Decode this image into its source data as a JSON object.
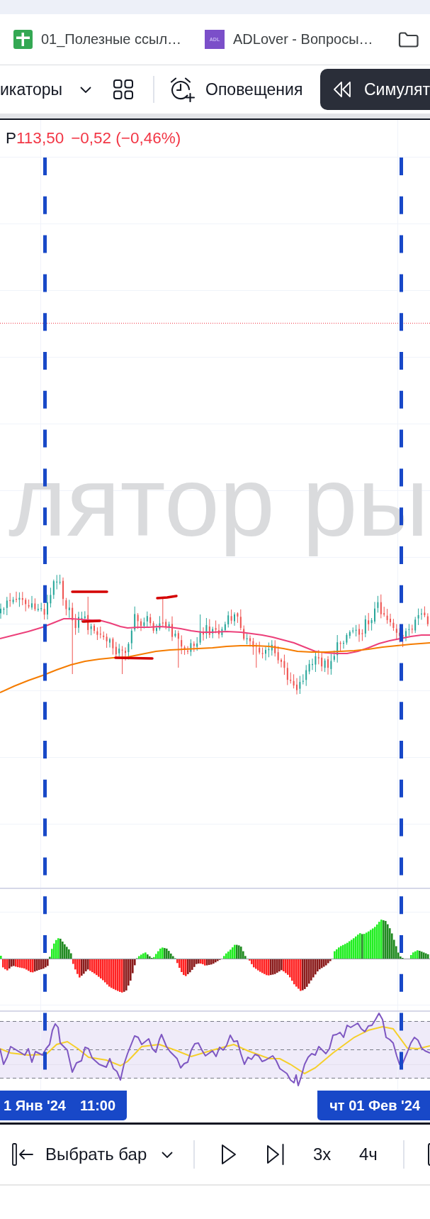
{
  "bookmarks": [
    {
      "kind": "sheet",
      "label": "01_Полезные ссыл…"
    },
    {
      "kind": "site",
      "logo_text": "ADL",
      "label": "ADLover - Вопросы…"
    },
    {
      "kind": "folder"
    }
  ],
  "toolbar": {
    "indicators_label": "икаторы",
    "alerts_label": "Оповещения",
    "replay_button": {
      "label": "Симулят",
      "active": true
    }
  },
  "chart": {
    "legend": {
      "symbol": "P",
      "price": "113,50",
      "change": "−0,52 (−0,46%)",
      "falling": true
    },
    "mode_watermark": "лятор ры"
  },
  "time_axis": {
    "labels": [
      {
        "date": "1 Янв '24",
        "time": "11:00"
      },
      {
        "date": "чт 01 Фев '24"
      }
    ]
  },
  "replay_bar": {
    "select_bar_label": "Выбрать бар",
    "speed": "3x",
    "interval": "4ч"
  }
}
